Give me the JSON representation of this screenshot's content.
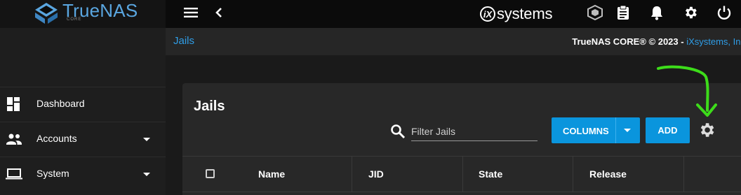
{
  "topbar": {
    "brand_name": "TrueNAS",
    "brand_edition": "CORE",
    "menu_icon": "hamburger-icon",
    "back_icon": "chevron-left-icon",
    "vendor_logo_mark": "iX",
    "vendor_logo_word": "systems",
    "icons": [
      "truecommand-icon",
      "clipboard-icon",
      "bell-icon",
      "gear-icon",
      "power-icon"
    ]
  },
  "sidebar": {
    "items": [
      {
        "label": "Dashboard",
        "icon": "dashboard-icon"
      },
      {
        "label": "Accounts",
        "icon": "people-icon"
      },
      {
        "label": "System",
        "icon": "laptop-icon"
      }
    ]
  },
  "breadcrumb": {
    "current": "Jails",
    "copyright": "TrueNAS CORE® © 2023 - ",
    "copyright_link": "iXsystems, Inc"
  },
  "card": {
    "title": "Jails",
    "filter_placeholder": "Filter Jails",
    "columns_button": "COLUMNS",
    "add_button": "ADD",
    "settings_icon": "gear-icon",
    "table": {
      "columns": [
        "Name",
        "JID",
        "State",
        "Release"
      ]
    }
  },
  "colors": {
    "accent": "#0a95dd",
    "link": "#2f9de6",
    "annotation": "#3ddc1a"
  }
}
